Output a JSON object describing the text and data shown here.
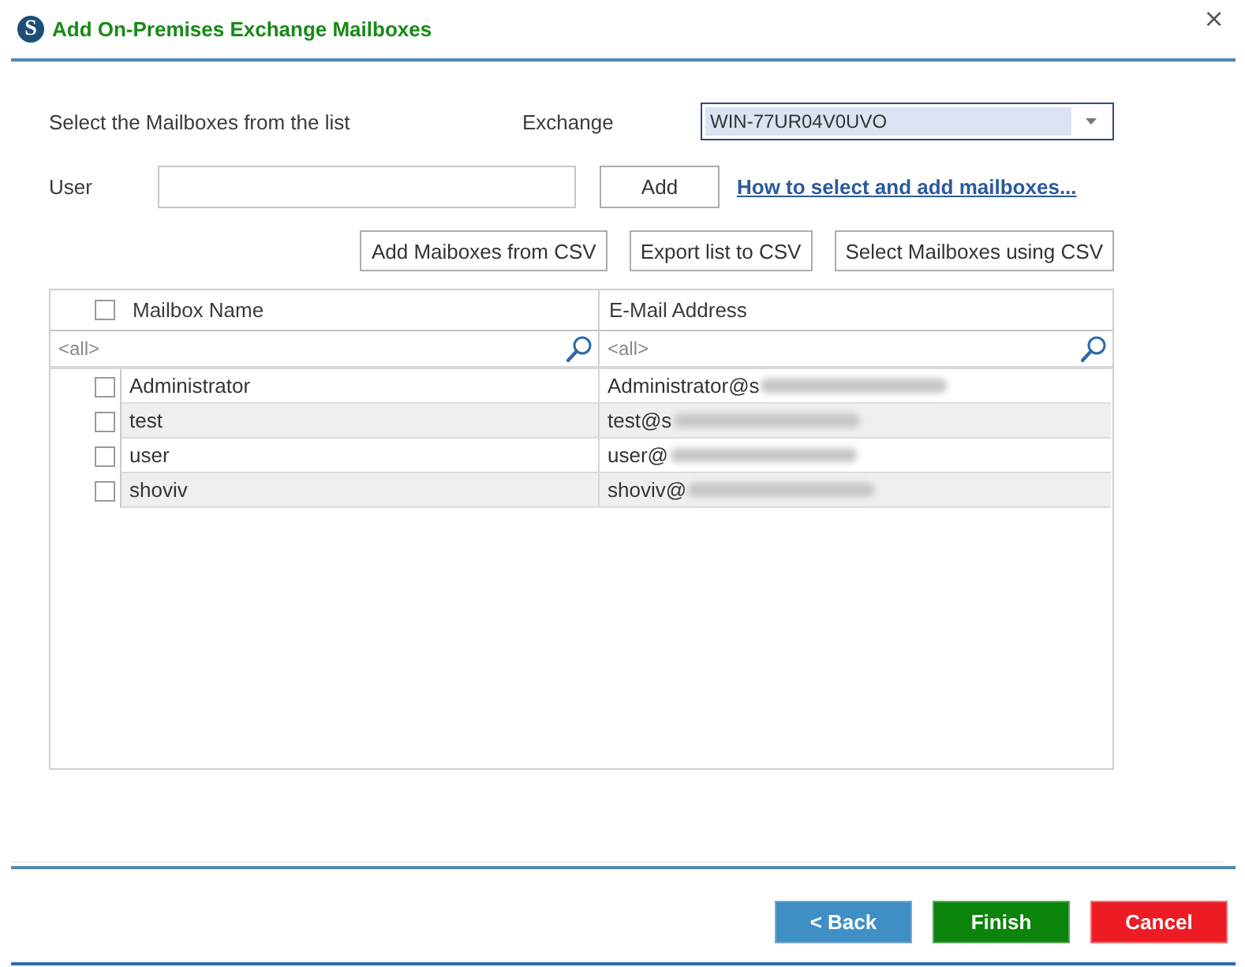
{
  "window": {
    "logo_letter": "S",
    "title": "Add On-Premises Exchange Mailboxes",
    "close": "×"
  },
  "prompt": "Select the Mailboxes from the list",
  "exchange": {
    "label": "Exchange",
    "value": "WIN-77UR04V0UVO",
    "highlighted": true
  },
  "user_field": {
    "label": "User"
  },
  "add_button": "Add",
  "help_link": "How to select and add mailboxes...",
  "csv_buttons": [
    "Add Maiboxes from CSV",
    "Export list to CSV",
    "Select Mailboxes using CSV"
  ],
  "grid": {
    "select_all": {
      "checked": false
    },
    "columns": [
      {
        "title": "Mailbox Name",
        "filter": "<all>"
      },
      {
        "title": "E-Mail Address",
        "filter": "<all>"
      }
    ],
    "rows": [
      {
        "checked": false,
        "name": "Administrator",
        "email": "Administrator@s",
        "redacted": true
      },
      {
        "checked": false,
        "name": "test",
        "email": "test@s",
        "redacted": true
      },
      {
        "checked": false,
        "name": "user",
        "email": "user@",
        "redacted": true
      },
      {
        "checked": false,
        "name": "shoviv",
        "email": "shoviv@",
        "redacted": true
      }
    ]
  },
  "footer_buttons": [
    {
      "label": "< Back",
      "kind": "back"
    },
    {
      "label": "Finish",
      "kind": "finish"
    },
    {
      "label": "Cancel",
      "kind": "cancel"
    }
  ]
}
